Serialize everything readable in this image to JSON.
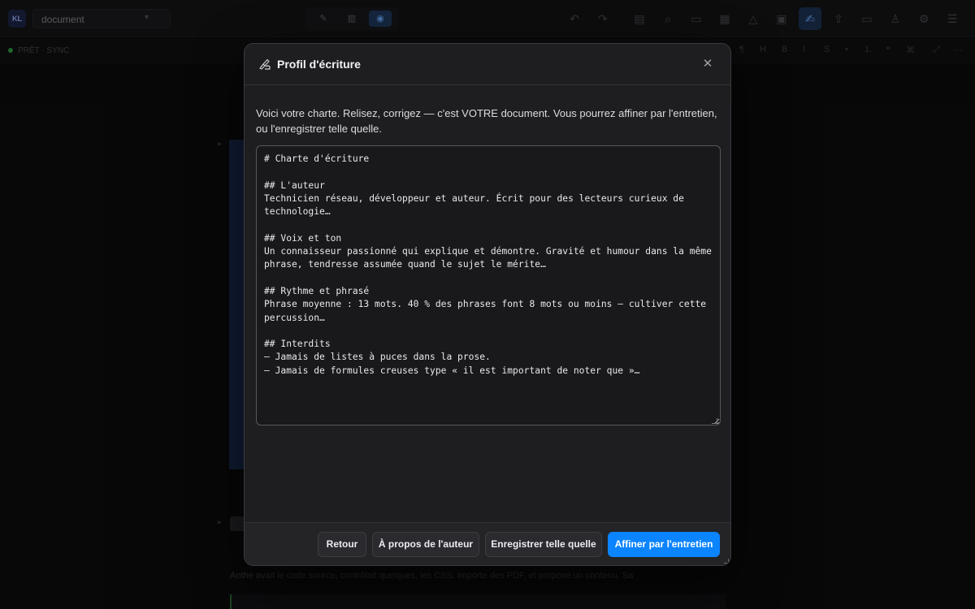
{
  "app": {
    "logo": "KL",
    "document_selector": "document",
    "status": "PRÊT · SYNC"
  },
  "background": {
    "paragraph": "Anthe avait le code source, contrôlait quelques, les CSS, importe des PDF, et propose un contenu. Sa"
  },
  "modal": {
    "title": "Profil d'écriture",
    "intro": "Voici votre charte. Relisez, corrigez — c'est VOTRE document. Vous pourrez affiner par l'entretien, ou l'enregistrer telle quelle.",
    "charter_text": "# Charte d'écriture\n\n## L'auteur\nTechnicien réseau, développeur et auteur. Écrit pour des lecteurs curieux de technologie…\n\n## Voix et ton\nUn connaisseur passionné qui explique et démontre. Gravité et humour dans la même phrase, tendresse assumée quand le sujet le mérite…\n\n## Rythme et phrasé\nPhrase moyenne : 13 mots. 40 % des phrases font 8 mots ou moins — cultiver cette percussion…\n\n## Interdits\n— Jamais de listes à puces dans la prose.\n— Jamais de formules creuses type « il est important de noter que »…",
    "buttons": {
      "back": "Retour",
      "about_author": "À propos de l'auteur",
      "save_as_is": "Enregistrer telle quelle",
      "refine": "Affiner par l'entretien"
    }
  },
  "icons": {
    "header": "writing-hand-icon",
    "close": "close-icon"
  },
  "colors": {
    "accent": "#0b84ff",
    "modal_bg": "#1e1e20",
    "page_bg": "#0c0c0d"
  }
}
